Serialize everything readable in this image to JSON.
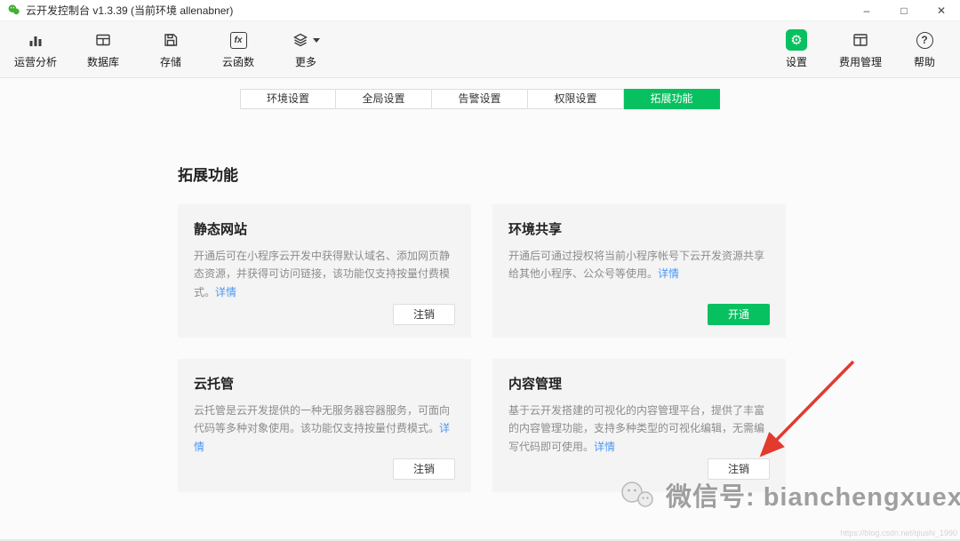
{
  "window": {
    "title": "云开发控制台 v1.3.39 (当前环境 allenabner)",
    "controls": {
      "minimize": "–",
      "maximize": "□",
      "close": "✕"
    }
  },
  "toolbar": {
    "left_items": [
      {
        "label": "运营分析",
        "icon": "bar-chart-icon"
      },
      {
        "label": "数据库",
        "icon": "database-icon"
      },
      {
        "label": "存储",
        "icon": "storage-icon"
      },
      {
        "label": "云函数",
        "icon": "cloud-function-icon"
      },
      {
        "label": "更多",
        "icon": "layers-icon",
        "has_dropdown": true
      }
    ],
    "right_items": [
      {
        "label": "设置",
        "icon": "gear-icon",
        "active": true
      },
      {
        "label": "费用管理",
        "icon": "billing-icon"
      },
      {
        "label": "帮助",
        "icon": "help-icon"
      }
    ]
  },
  "icons": {
    "gear_glyph": "⚙",
    "fx_glyph": "fx",
    "help_glyph": "?"
  },
  "tabs": [
    {
      "label": "环境设置",
      "active": false
    },
    {
      "label": "全局设置",
      "active": false
    },
    {
      "label": "告警设置",
      "active": false
    },
    {
      "label": "权限设置",
      "active": false
    },
    {
      "label": "拓展功能",
      "active": true
    }
  ],
  "page": {
    "heading": "拓展功能",
    "cards": [
      {
        "title": "静态网站",
        "description": "开通后可在小程序云开发中获得默认域名、添加网页静态资源，并获得可访问链接，该功能仅支持按量付费模式。",
        "link": "详情",
        "button_label": "注销",
        "button_style": "plain"
      },
      {
        "title": "环境共享",
        "description": "开通后可通过授权将当前小程序帐号下云开发资源共享给其他小程序、公众号等使用。",
        "link": "详情",
        "button_label": "开通",
        "button_style": "primary"
      },
      {
        "title": "云托管",
        "description": "云托管是云开发提供的一种无服务器容器服务，可面向代码等多种对象使用。该功能仅支持按量付费模式。",
        "link": "详情",
        "button_label": "注销",
        "button_style": "plain"
      },
      {
        "title": "内容管理",
        "description": "基于云开发搭建的可视化的内容管理平台，提供了丰富的内容管理功能，支持多种类型的可视化编辑，无需编写代码即可使用。",
        "link": "详情",
        "button_label": "注销",
        "button_style": "plain"
      }
    ]
  },
  "watermark": {
    "text": "微信号: bianchengxuexi",
    "url": "https://blog.csdn.net/qiushi_1990"
  },
  "colors": {
    "accent_green": "#07c160",
    "link_blue": "#4a97f7",
    "arrow_red": "#e23b2e"
  }
}
